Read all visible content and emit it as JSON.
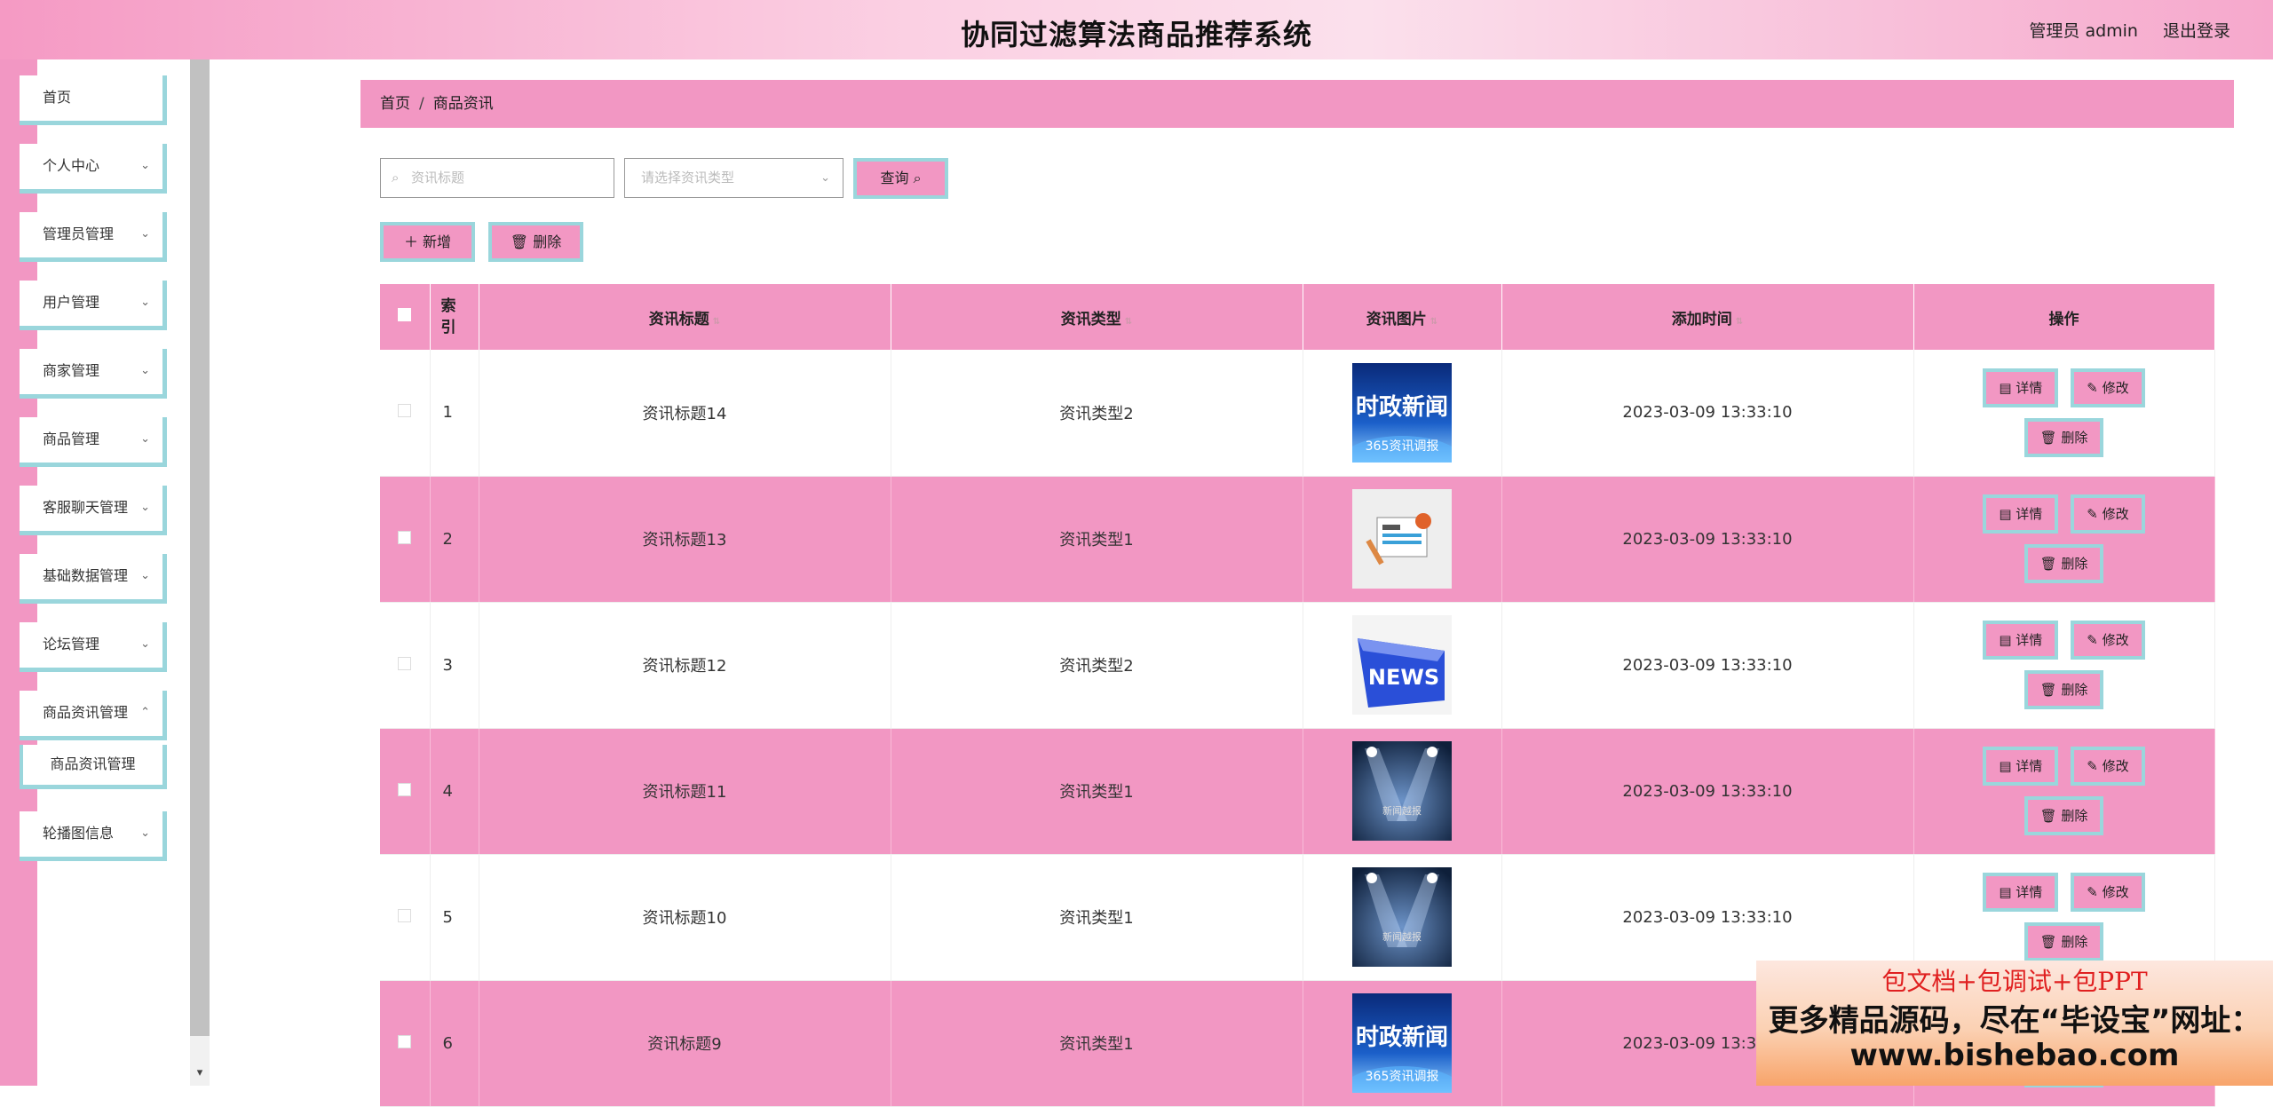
{
  "header": {
    "title": "协同过滤算法商品推荐系统",
    "user_label": "管理员 admin",
    "logout_label": "退出登录"
  },
  "sidebar": {
    "items": [
      {
        "label": "首页",
        "has_children": false
      },
      {
        "label": "个人中心",
        "has_children": true
      },
      {
        "label": "管理员管理",
        "has_children": true
      },
      {
        "label": "用户管理",
        "has_children": true
      },
      {
        "label": "商家管理",
        "has_children": true
      },
      {
        "label": "商品管理",
        "has_children": true
      },
      {
        "label": "客服聊天管理",
        "has_children": true
      },
      {
        "label": "基础数据管理",
        "has_children": true
      },
      {
        "label": "论坛管理",
        "has_children": true
      },
      {
        "label": "商品资讯管理",
        "has_children": true,
        "expanded": true
      },
      {
        "label": "轮播图信息",
        "has_children": true
      }
    ],
    "submenu_label": "商品资讯管理"
  },
  "breadcrumb": {
    "home": "首页",
    "separator": "/",
    "current": "商品资讯"
  },
  "search": {
    "title_placeholder": "资讯标题",
    "type_placeholder": "请选择资讯类型",
    "query_label": "查询"
  },
  "actions": {
    "add_label": "新增",
    "delete_label": "删除"
  },
  "table": {
    "columns": [
      "索引",
      "资讯标题",
      "资讯类型",
      "资讯图片",
      "添加时间",
      "操作"
    ],
    "row_buttons": {
      "detail": "详情",
      "edit": "修改",
      "delete": "删除"
    },
    "rows": [
      {
        "index": "1",
        "title": "资讯标题14",
        "type": "资讯类型2",
        "time": "2023-03-09 13:33:10",
        "image": "news-politics"
      },
      {
        "index": "2",
        "title": "资讯标题13",
        "type": "资讯类型1",
        "time": "2023-03-09 13:33:10",
        "image": "newspaper"
      },
      {
        "index": "3",
        "title": "资讯标题12",
        "type": "资讯类型2",
        "time": "2023-03-09 13:33:10",
        "image": "news-key"
      },
      {
        "index": "4",
        "title": "资讯标题11",
        "type": "资讯类型1",
        "time": "2023-03-09 13:33:10",
        "image": "spotlight"
      },
      {
        "index": "5",
        "title": "资讯标题10",
        "type": "资讯类型1",
        "time": "2023-03-09 13:33:10",
        "image": "spotlight"
      },
      {
        "index": "6",
        "title": "资讯标题9",
        "type": "资讯类型1",
        "time": "2023-03-09 13:33:10",
        "image": "news-politics"
      }
    ]
  },
  "thumb_text": {
    "politics_main": "时政新闻",
    "politics_sub": "365资讯调报",
    "news": "NEWS",
    "spot": "新闻越报"
  },
  "watermark": {
    "line1": "包文档+包调试+包PPT",
    "line2": "更多精品源码，尽在“毕设宝”网址：",
    "line3": "www.bishebao.com"
  },
  "colors": {
    "accent": "#f297c3",
    "border_accent": "#9ad6dc"
  }
}
